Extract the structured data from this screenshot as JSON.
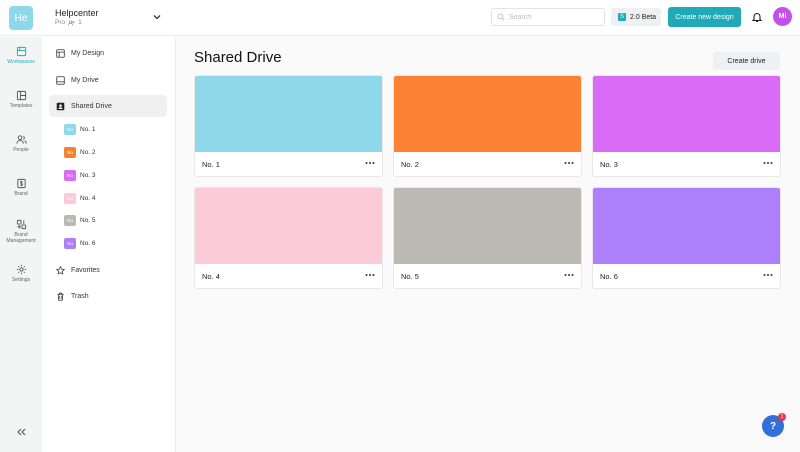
{
  "header": {
    "workspace_initials": "He",
    "workspace_name": "Helpcenter",
    "plan": "Pro",
    "member_count": "1",
    "search_placeholder": "Search",
    "beta_label": "2.0 Beta",
    "create_design_label": "Create new design",
    "avatar_initials": "Mi"
  },
  "rail": {
    "items": [
      {
        "label": "Workspaces",
        "icon": "workspaces-icon"
      },
      {
        "label": "Templates",
        "icon": "templates-icon"
      },
      {
        "label": "People",
        "icon": "people-icon"
      },
      {
        "label": "Brand",
        "icon": "brand-icon"
      },
      {
        "label": "Brand Management",
        "icon": "brand-management-icon"
      },
      {
        "label": "Settings",
        "icon": "gear-icon"
      }
    ]
  },
  "sidebar": {
    "items": [
      {
        "label": "My Design"
      },
      {
        "label": "My Drive"
      },
      {
        "label": "Shared Drive"
      },
      {
        "label": "Favorites"
      },
      {
        "label": "Trash"
      }
    ],
    "sub_items": [
      {
        "badge": "No",
        "label": "No. 1",
        "color": "#8ed8ea"
      },
      {
        "badge": "No",
        "label": "No. 2",
        "color": "#f5822f"
      },
      {
        "badge": "No",
        "label": "No. 3",
        "color": "#d96bf7"
      },
      {
        "badge": "No",
        "label": "No. 4",
        "color": "#fbcad9"
      },
      {
        "badge": "No",
        "label": "No. 5",
        "color": "#bcb9b2"
      },
      {
        "badge": "No",
        "label": "No. 6",
        "color": "#ad7ffa"
      }
    ]
  },
  "main": {
    "title": "Shared Drive",
    "create_drive_label": "Create drive",
    "drives": [
      {
        "name": "No. 1",
        "color": "#8ed8ea"
      },
      {
        "name": "No. 2",
        "color": "#fe8235"
      },
      {
        "name": "No. 3",
        "color": "#da6bf7"
      },
      {
        "name": "No. 4",
        "color": "#fccbd9"
      },
      {
        "name": "No. 5",
        "color": "#bcb9b2"
      },
      {
        "name": "No. 6",
        "color": "#ae7ffa"
      }
    ]
  },
  "help": {
    "badge_count": "1",
    "icon_glyph": "?"
  }
}
